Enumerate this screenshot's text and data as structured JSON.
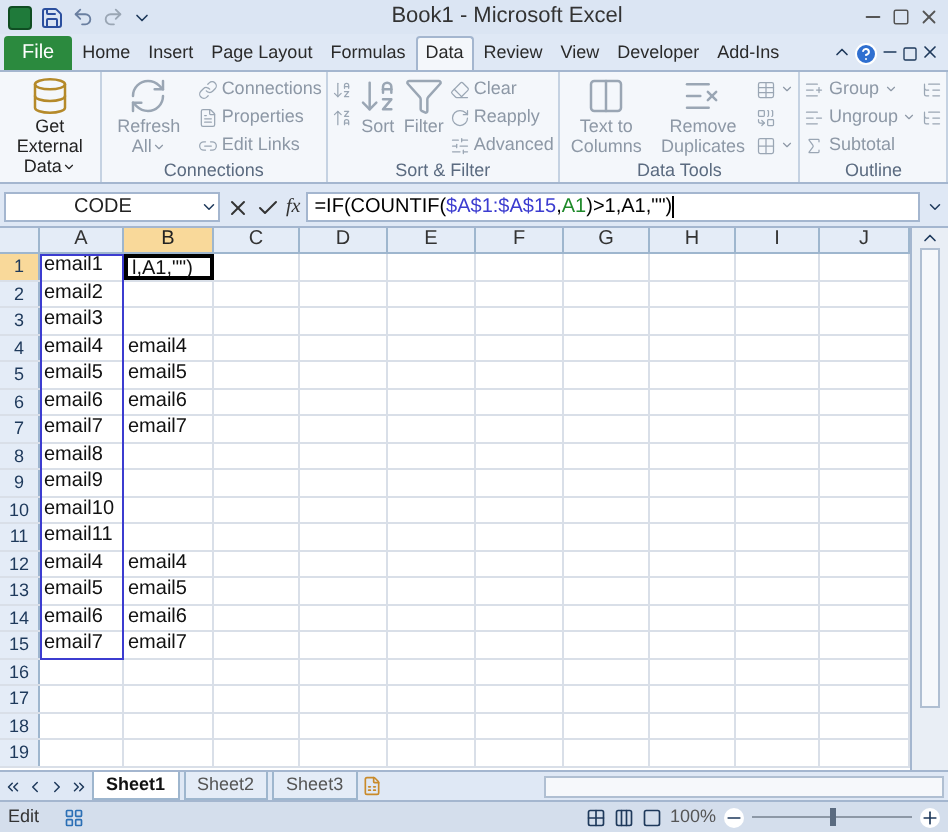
{
  "title_bar": {
    "title": "Book1 - Microsoft Excel"
  },
  "tabs": [
    {
      "label": "File",
      "kind": "file",
      "selected": false
    },
    {
      "label": "Home",
      "kind": "tab",
      "selected": false
    },
    {
      "label": "Insert",
      "kind": "tab",
      "selected": false
    },
    {
      "label": "Page Layout",
      "kind": "tab",
      "selected": false
    },
    {
      "label": "Formulas",
      "kind": "tab",
      "selected": false
    },
    {
      "label": "Data",
      "kind": "tab",
      "selected": true
    },
    {
      "label": "Review",
      "kind": "tab",
      "selected": false
    },
    {
      "label": "View",
      "kind": "tab",
      "selected": false
    },
    {
      "label": "Developer",
      "kind": "tab",
      "selected": false
    },
    {
      "label": "Add-Ins",
      "kind": "tab",
      "selected": false
    }
  ],
  "ribbon": {
    "groups": [
      {
        "items": [
          {
            "kind": "large",
            "label": "Get External Data",
            "dropdown": true,
            "disabled": false
          }
        ]
      },
      {
        "label": "Connections",
        "items": [
          {
            "kind": "large",
            "label": "Refresh All",
            "dropdown": true,
            "disabled": true
          },
          {
            "kind": "stack",
            "items": [
              {
                "label": "Connections",
                "dropdown": false,
                "disabled": true
              },
              {
                "label": "Properties",
                "dropdown": false,
                "disabled": true
              },
              {
                "label": "Edit Links",
                "dropdown": false,
                "disabled": true
              }
            ]
          }
        ]
      },
      {
        "label": "Sort & Filter",
        "items": [
          {
            "kind": "stack",
            "items": [
              {
                "dropdown": false,
                "disabled": true
              },
              {
                "dropdown": false,
                "disabled": true
              }
            ]
          },
          {
            "kind": "large",
            "label": "Sort",
            "dropdown": false,
            "disabled": true
          },
          {
            "kind": "large",
            "label": "Filter",
            "dropdown": false,
            "disabled": true
          },
          {
            "kind": "stack",
            "items": [
              {
                "label": "Clear",
                "dropdown": false,
                "disabled": true
              },
              {
                "label": "Reapply",
                "dropdown": false,
                "disabled": true
              },
              {
                "label": "Advanced",
                "dropdown": false,
                "disabled": true
              }
            ]
          }
        ]
      },
      {
        "label": "Data Tools",
        "items": [
          {
            "kind": "large",
            "label": "Text to Columns",
            "dropdown": false,
            "disabled": true
          },
          {
            "kind": "large",
            "label": "Remove Duplicates",
            "dropdown": false,
            "disabled": true
          },
          {
            "kind": "stack",
            "items": [
              {
                "dropdown": true,
                "disabled": true
              },
              {
                "dropdown": false,
                "disabled": true
              },
              {
                "dropdown": true,
                "disabled": true
              }
            ]
          }
        ]
      },
      {
        "label": "Outline",
        "items": [
          {
            "kind": "stack",
            "items": [
              {
                "label": "Group",
                "dropdown": true,
                "disabled": true
              },
              {
                "label": "Ungroup",
                "dropdown": true,
                "disabled": true
              },
              {
                "label": "Subtotal",
                "dropdown": false,
                "disabled": true
              }
            ]
          },
          {
            "kind": "stack",
            "items": [
              {
                "dropdown": false,
                "disabled": true
              },
              {
                "dropdown": false,
                "disabled": true
              }
            ]
          }
        ]
      }
    ]
  },
  "formula_bar": {
    "name_box": "CODE",
    "function_label": "fx",
    "segments": [
      {
        "text": "=IF(COUNTIF("
      },
      {
        "text": "$A$1:$A$15",
        "color": "#3c3cd0"
      },
      {
        "text": ","
      },
      {
        "text": "A1",
        "color": "#1f8a2a"
      },
      {
        "text": ")>1,A1,\"\")"
      }
    ]
  },
  "sheet": {
    "reference_outline": true,
    "columns": [
      {
        "label": "A",
        "selected": false
      },
      {
        "label": "B",
        "selected": true
      },
      {
        "label": "C",
        "selected": false
      },
      {
        "label": "D",
        "selected": false
      },
      {
        "label": "E",
        "selected": false
      },
      {
        "label": "F",
        "selected": false
      },
      {
        "label": "G",
        "selected": false
      },
      {
        "label": "H",
        "selected": false
      },
      {
        "label": "I",
        "selected": false
      },
      {
        "label": "J",
        "selected": false
      }
    ],
    "rows": [
      {
        "number": "1",
        "a": "email1",
        "b": "l,A1,\"\")",
        "selected": true
      },
      {
        "number": "2",
        "a": "email2",
        "selected": false
      },
      {
        "number": "3",
        "a": "email3",
        "selected": false
      },
      {
        "number": "4",
        "a": "email4",
        "b": "email4",
        "selected": false
      },
      {
        "number": "5",
        "a": "email5",
        "b": "email5",
        "selected": false
      },
      {
        "number": "6",
        "a": "email6",
        "b": "email6",
        "selected": false
      },
      {
        "number": "7",
        "a": "email7",
        "b": "email7",
        "selected": false
      },
      {
        "number": "8",
        "a": "email8",
        "selected": false
      },
      {
        "number": "9",
        "a": "email9",
        "selected": false
      },
      {
        "number": "10",
        "a": "email10",
        "selected": false
      },
      {
        "number": "11",
        "a": "email11",
        "selected": false
      },
      {
        "number": "12",
        "a": "email4",
        "b": "email4",
        "selected": false
      },
      {
        "number": "13",
        "a": "email5",
        "b": "email5",
        "selected": false
      },
      {
        "number": "14",
        "a": "email6",
        "b": "email6",
        "selected": false
      },
      {
        "number": "15",
        "a": "email7",
        "b": "email7",
        "selected": false
      },
      {
        "number": "16",
        "selected": false
      },
      {
        "number": "17",
        "selected": false
      },
      {
        "number": "18",
        "selected": false
      },
      {
        "number": "19",
        "selected": false
      }
    ]
  },
  "sheet_tabs": [
    {
      "label": "Sheet1",
      "selected": true
    },
    {
      "label": "Sheet2",
      "selected": false
    },
    {
      "label": "Sheet3",
      "selected": false
    }
  ],
  "status_bar": {
    "mode": "Edit",
    "zoom": "100%",
    "zoom_slider": {
      "level": 0.5
    }
  }
}
